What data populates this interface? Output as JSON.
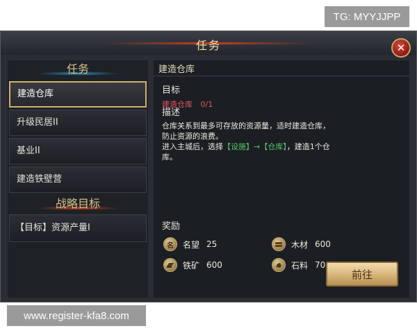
{
  "overlays": {
    "tg": "TG: MYYJJPP",
    "url": "www.register-kfa8.com"
  },
  "window": {
    "title": "任务",
    "close_icon": "close-icon"
  },
  "left": {
    "tasks_heading": "任务",
    "tasks": [
      {
        "label": "建造仓库",
        "active": true
      },
      {
        "label": "升级民居II",
        "active": false
      },
      {
        "label": "基业II",
        "active": false
      },
      {
        "label": "建造铁壁营",
        "active": false
      }
    ],
    "strategy_heading": "战略目标",
    "strategy_items": [
      {
        "label": "【目标】资源产量I"
      }
    ]
  },
  "detail": {
    "title": "建造仓库",
    "goal_label": "目标",
    "goal_name": "建造仓库",
    "goal_progress": "0/1",
    "desc_label": "描述",
    "desc_line1": "仓库关系到最多可存放的资源量，适时建造仓库，",
    "desc_line2": "防止资源的浪费。",
    "desc_line3_a": "进入主城后，选择",
    "desc_line3_b": "【设施】→【仓库】",
    "desc_line3_c": "，建造1个仓",
    "desc_line4": "库。",
    "reward_label": "奖励",
    "rewards": [
      {
        "name": "名望",
        "value": "25",
        "icon": "prestige-icon",
        "glyph": "名"
      },
      {
        "name": "木材",
        "value": "600",
        "icon": "wood-icon",
        "glyph": ""
      },
      {
        "name": "铁矿",
        "value": "600",
        "icon": "iron-icon",
        "glyph": ""
      },
      {
        "name": "石料",
        "value": "700",
        "icon": "stone-icon",
        "glyph": ""
      }
    ],
    "go_button": "前往"
  }
}
